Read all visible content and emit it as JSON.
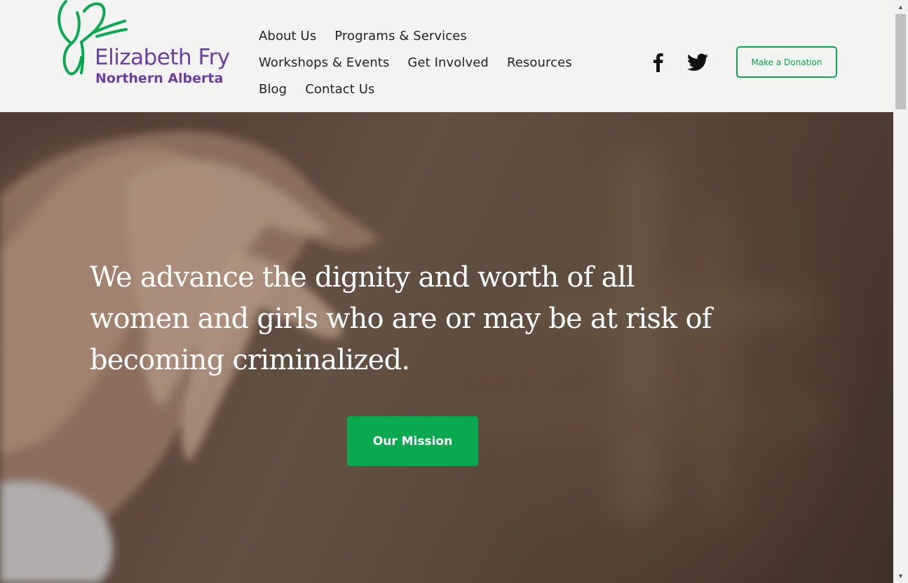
{
  "brand": {
    "line1": "Elizabeth Fry",
    "line2": "Northern Alberta",
    "primary_color": "#6b3fa0",
    "accent_color": "#0fa24f"
  },
  "nav": {
    "row1": [
      "About Us",
      "Programs & Services"
    ],
    "row2": [
      "Workshops & Events",
      "Get Involved",
      "Resources"
    ],
    "row3": [
      "Blog",
      "Contact Us"
    ]
  },
  "social": {
    "facebook_icon": "facebook-icon",
    "twitter_icon": "twitter-icon"
  },
  "header": {
    "donate_label": "Make a Donation"
  },
  "hero": {
    "headline_line1": "We advance the dignity and worth of all",
    "headline_line2": "women and girls who are or may be at risk of",
    "headline_line3": "becoming criminalized.",
    "cta_label": "Our Mission",
    "cta_color": "#0aa84f"
  }
}
